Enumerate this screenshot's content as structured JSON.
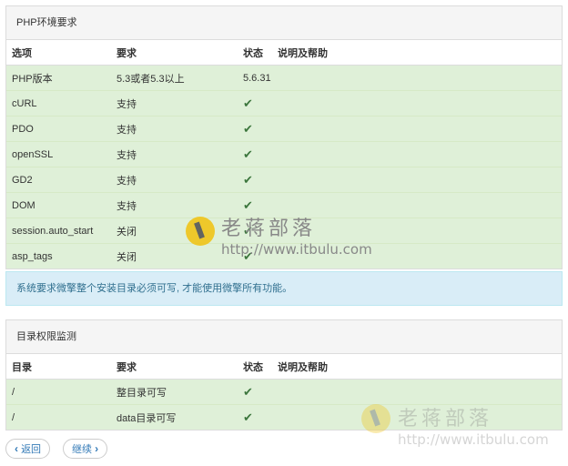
{
  "env_panel": {
    "title": "PHP环境要求",
    "headers": [
      "选项",
      "要求",
      "状态",
      "说明及帮助"
    ],
    "rows": [
      {
        "item": "PHP版本",
        "req": "5.3或者5.3以上",
        "status": "5.6.31"
      },
      {
        "item": "cURL",
        "req": "支持",
        "status": "✔"
      },
      {
        "item": "PDO",
        "req": "支持",
        "status": "✔"
      },
      {
        "item": "openSSL",
        "req": "支持",
        "status": "✔"
      },
      {
        "item": "GD2",
        "req": "支持",
        "status": "✔"
      },
      {
        "item": "DOM",
        "req": "支持",
        "status": "✔"
      },
      {
        "item": "session.auto_start",
        "req": "关闭",
        "status": "✔"
      },
      {
        "item": "asp_tags",
        "req": "关闭",
        "status": "✔"
      }
    ]
  },
  "notice": "系统要求微擎整个安装目录必须可写, 才能使用微擎所有功能。",
  "dir_panel": {
    "title": "目录权限监测",
    "headers": [
      "目录",
      "要求",
      "状态",
      "说明及帮助"
    ],
    "rows": [
      {
        "dir": "/",
        "req": "整目录可写",
        "status": "✔"
      },
      {
        "dir": "/",
        "req": "data目录可写",
        "status": "✔"
      }
    ]
  },
  "buttons": {
    "back": "返回",
    "next": "继续"
  },
  "watermark": {
    "name": "老蒋部落",
    "url": "http://www.itbulu.com"
  },
  "colors": {
    "ok_row": "#dff0d8",
    "check": "#3c763d",
    "alert_bg": "#d9edf7",
    "link": "#337ab7"
  }
}
